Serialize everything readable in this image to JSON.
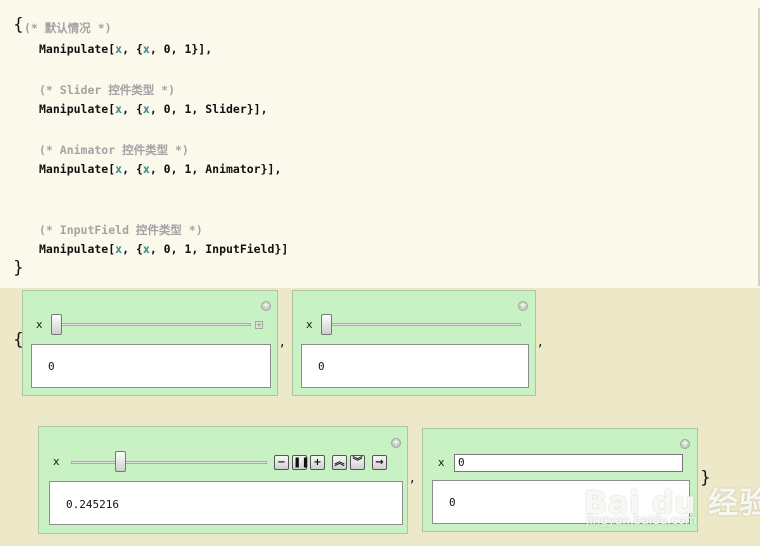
{
  "input": {
    "open_brace": "{",
    "close_brace": "}",
    "lines": [
      {
        "kind": "comment",
        "text": "(* 默认情况 *)"
      },
      {
        "kind": "code",
        "prefix": "Manipulate[",
        "v1": "x",
        "mid": ", {",
        "v2": "x",
        "suffix": ", 0, 1}],"
      },
      {
        "kind": "comment",
        "text": "(* Slider 控件类型 *)"
      },
      {
        "kind": "code",
        "prefix": "Manipulate[",
        "v1": "x",
        "mid": ", {",
        "v2": "x",
        "suffix": ", 0, 1, Slider}],"
      },
      {
        "kind": "comment",
        "text": "(* Animator 控件类型 *)"
      },
      {
        "kind": "code",
        "prefix": "Manipulate[",
        "v1": "x",
        "mid": ", {",
        "v2": "x",
        "suffix": ", 0, 1, Animator}],"
      },
      {
        "kind": "comment",
        "text": "(* InputField 控件类型 *)"
      },
      {
        "kind": "code",
        "prefix": "Manipulate[",
        "v1": "x",
        "mid": ", {",
        "v2": "x",
        "suffix": ", 0, 1, InputField}]"
      }
    ]
  },
  "output": {
    "open_brace": "{",
    "close_brace": "}",
    "comma": ",",
    "panels": [
      {
        "control": "slider",
        "var_label": "x",
        "value": "0",
        "slider_position": 0.0
      },
      {
        "control": "slider",
        "var_label": "x",
        "value": "0",
        "slider_position": 0.0
      },
      {
        "control": "animator",
        "var_label": "x",
        "value": "0.245216",
        "slider_position": 0.245216
      },
      {
        "control": "inputfield",
        "var_label": "x",
        "field_value": "0",
        "value": "0"
      }
    ],
    "animator_buttons": [
      "minus-icon",
      "pause-icon",
      "plus-icon",
      "faster-icon",
      "slower-icon",
      "direction-icon"
    ]
  },
  "watermark": {
    "logo": "Bai du 经验",
    "url": "jingyan.baidu.com"
  },
  "colors": {
    "notebook_bg": "#ede8c8",
    "input_cell_bg": "#fbf8ec",
    "panel_bg": "#c8f2c4",
    "comment": "#a3a3a3",
    "variable": "#3b8b8b"
  }
}
